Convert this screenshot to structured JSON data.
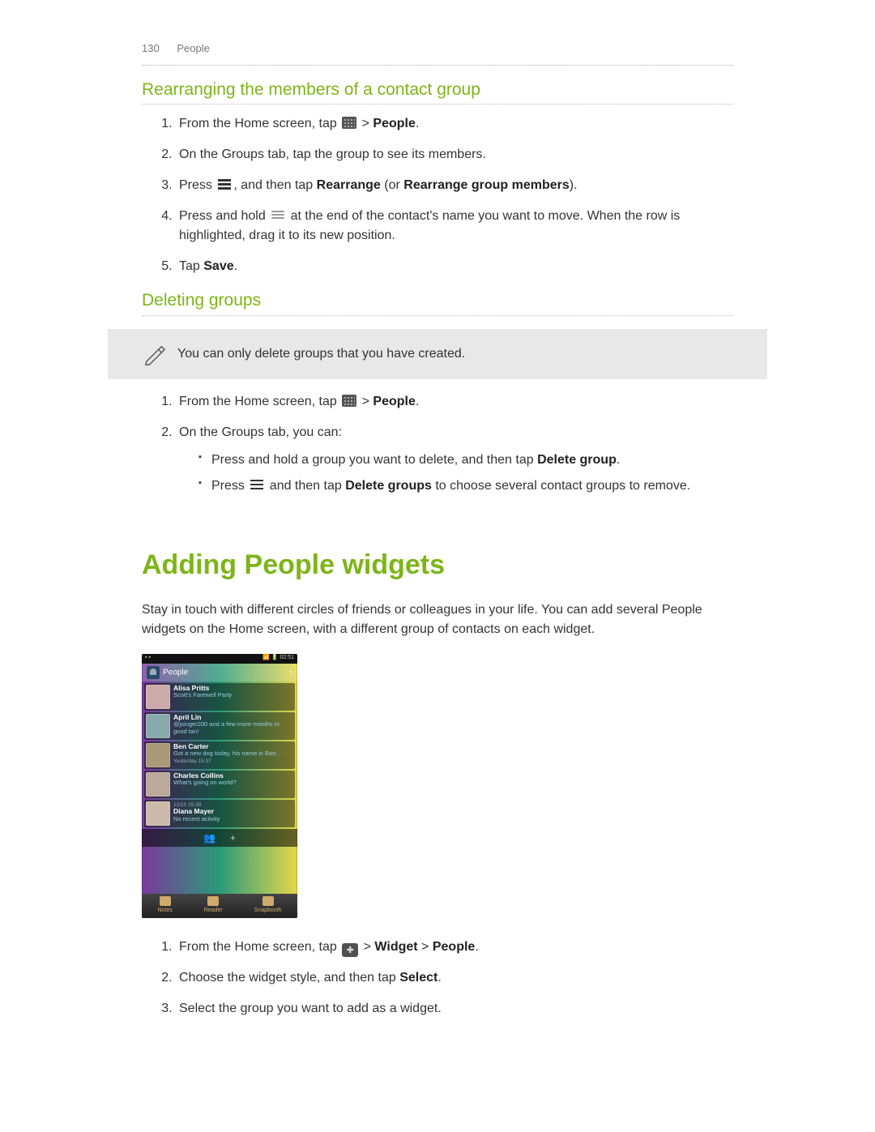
{
  "header": {
    "page_number": "130",
    "section": "People"
  },
  "rearranging": {
    "title": "Rearranging the members of a contact group",
    "steps": [
      {
        "pre": "From the Home screen, tap ",
        "icon": "apps",
        "post": " > ",
        "bold": "People",
        "tail": "."
      },
      {
        "text": "On the Groups tab, tap the group to see its members."
      },
      {
        "pre": "Press ",
        "icon": "menu",
        "post": ", and then tap ",
        "bold": "Rearrange",
        "tail": " (or ",
        "bold2": "Rearrange group members",
        "tail2": ")."
      },
      {
        "pre": "Press and hold ",
        "icon": "drag",
        "post": " at the end of the contact's name you want to move. When the row is highlighted, drag it to its new position."
      },
      {
        "pre": "Tap ",
        "bold": "Save",
        "tail": "."
      }
    ]
  },
  "deleting": {
    "title": "Deleting groups",
    "note": "You can only delete groups that you have created.",
    "steps": [
      {
        "pre": "From the Home screen, tap ",
        "icon": "apps",
        "post": " > ",
        "bold": "People",
        "tail": "."
      },
      {
        "text": "On the Groups tab, you can:"
      }
    ],
    "bullets": [
      {
        "pre": "Press and hold a group you want to delete, and then tap ",
        "bold": "Delete group",
        "tail": "."
      },
      {
        "pre": "Press ",
        "icon": "menu",
        "post": " and then tap ",
        "bold": "Delete groups",
        "tail": " to choose several contact groups to remove."
      }
    ]
  },
  "adding": {
    "title": "Adding People widgets",
    "intro": "Stay in touch with different circles of friends or colleagues in your life. You can add several People widgets on the Home screen, with a different group of contacts on each widget.",
    "status_time": "02:51",
    "widget_label": "People",
    "contacts": [
      {
        "name": "Alisa Pritts",
        "status": "Scott's Farewell Party",
        "meta": ""
      },
      {
        "name": "April Lin",
        "status": "@jsinger200 and a few more months to good tan!",
        "meta": ""
      },
      {
        "name": "Ben Carter",
        "status": "Got a new dog today, his name is Bart…",
        "meta": "Yesterday 15:37"
      },
      {
        "name": "Charles Collins",
        "status": "What's going on world?",
        "meta": ""
      },
      {
        "name": "Diana Mayer",
        "status": "No recent activity",
        "meta": "12/10 15:39"
      }
    ],
    "dock": [
      "Notes",
      "Reader",
      "Snapbooth"
    ],
    "steps": [
      {
        "pre": "From the Home screen, tap ",
        "icon": "plus-home",
        "post": " > ",
        "bold": "Widget",
        "mid": " > ",
        "bold2": "People",
        "tail": "."
      },
      {
        "pre": "Choose the widget style, and then tap ",
        "bold": "Select",
        "tail": "."
      },
      {
        "text": "Select the group you want to add as a widget."
      }
    ]
  }
}
